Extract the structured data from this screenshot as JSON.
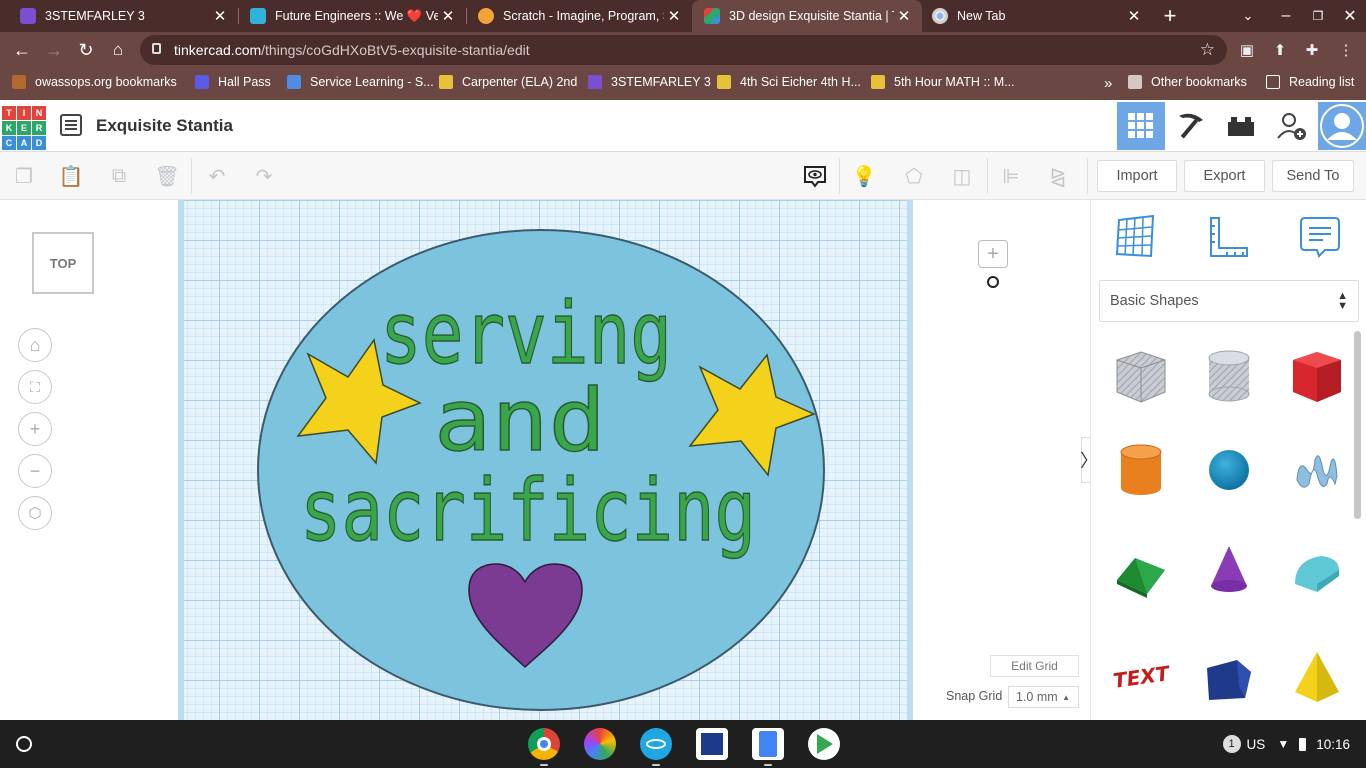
{
  "browser": {
    "tabs": [
      {
        "title": "3STEMFARLEY 3",
        "favicon_color": "#7a4fd0"
      },
      {
        "title": "Future Engineers :: We ❤️ Vete",
        "favicon_color": "#2fb3d8"
      },
      {
        "title": "Scratch - Imagine, Program, Sh",
        "favicon_color": "#f2a33b"
      },
      {
        "title": "3D design Exquisite Stantia | T",
        "favicon_color": "#e2433a"
      },
      {
        "title": "New Tab",
        "favicon_color": "#8ab4f8"
      }
    ],
    "new_tab_symbol": "+",
    "url_host": "tinkercad.com",
    "url_path": "/things/coGdHXoBtV5-exquisite-stantia/edit",
    "bookmarks": [
      {
        "label": "owassops.org bookmarks",
        "color": "#b06a2e"
      },
      {
        "label": "Hall Pass",
        "color": "#5b5be6"
      },
      {
        "label": "Service Learning - S...",
        "color": "#4d8de6"
      },
      {
        "label": "Carpenter (ELA) 2nd",
        "color": "#e6c23a"
      },
      {
        "label": "3STEMFARLEY 3",
        "color": "#7a4fd0"
      },
      {
        "label": "4th Sci Eicher 4th H...",
        "color": "#e6c23a"
      },
      {
        "label": "5th Hour MATH :: M...",
        "color": "#e6c23a"
      }
    ],
    "overflow_symbol": "»",
    "other_bookmarks": "Other bookmarks",
    "reading_list": "Reading list"
  },
  "tinkercad": {
    "logo_letters": [
      "T",
      "I",
      "N",
      "K",
      "E",
      "R",
      "C",
      "A",
      "D"
    ],
    "logo_colors": [
      "#e2433a",
      "#e2433a",
      "#e2433a",
      "#2aa86b",
      "#2aa86b",
      "#2aa86b",
      "#3a8fd8",
      "#3a8fd8",
      "#3a8fd8"
    ],
    "design_title": "Exquisite Stantia",
    "accent": "#6ea6e6",
    "toolbar_buttons": {
      "import": "Import",
      "export": "Export",
      "send_to": "Send To"
    },
    "view_cube_label": "TOP",
    "edit_grid": "Edit Grid",
    "snap_grid_label": "Snap Grid",
    "snap_grid_value": "1.0 mm",
    "collapse_symbol": "〉",
    "shape_library": "Basic Shapes",
    "design_text": {
      "line1": "serving",
      "line2": "and",
      "line3": "sacrificing"
    },
    "design_colors": {
      "badge": "#7cc3de",
      "text": "#3aa64a",
      "stars": "#f4d21c",
      "heart": "#7b3b93"
    }
  },
  "shelf": {
    "notification_count": "1",
    "keyboard": "US",
    "time": "10:16"
  }
}
